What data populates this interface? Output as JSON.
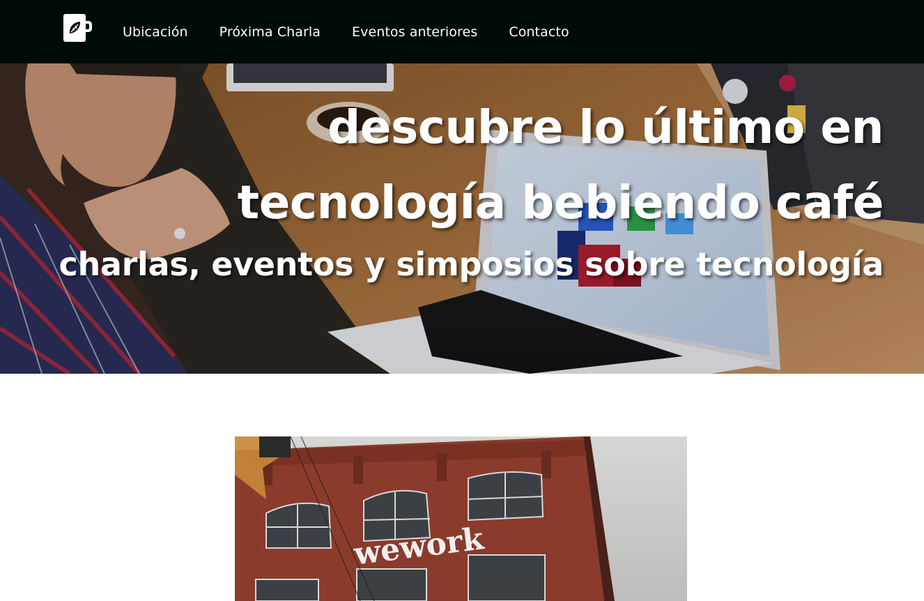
{
  "nav": {
    "logo_icon": "coffee-cup-leaf-icon",
    "links": [
      {
        "label": "Ubicación"
      },
      {
        "label": "Próxima Charla"
      },
      {
        "label": "Eventos anteriores"
      },
      {
        "label": "Contacto"
      }
    ]
  },
  "hero": {
    "title_line1": "descubre lo último en",
    "title_line2": "tecnología bebiendo café",
    "subtitle": "charlas, eventos y simposios sobre tecnología"
  },
  "venue": {
    "sign_text": "wework"
  },
  "colors": {
    "navbar_bg": "#000a06",
    "nav_text": "#ffffff",
    "hero_text": "#ffffff",
    "page_bg": "#ffffff"
  }
}
